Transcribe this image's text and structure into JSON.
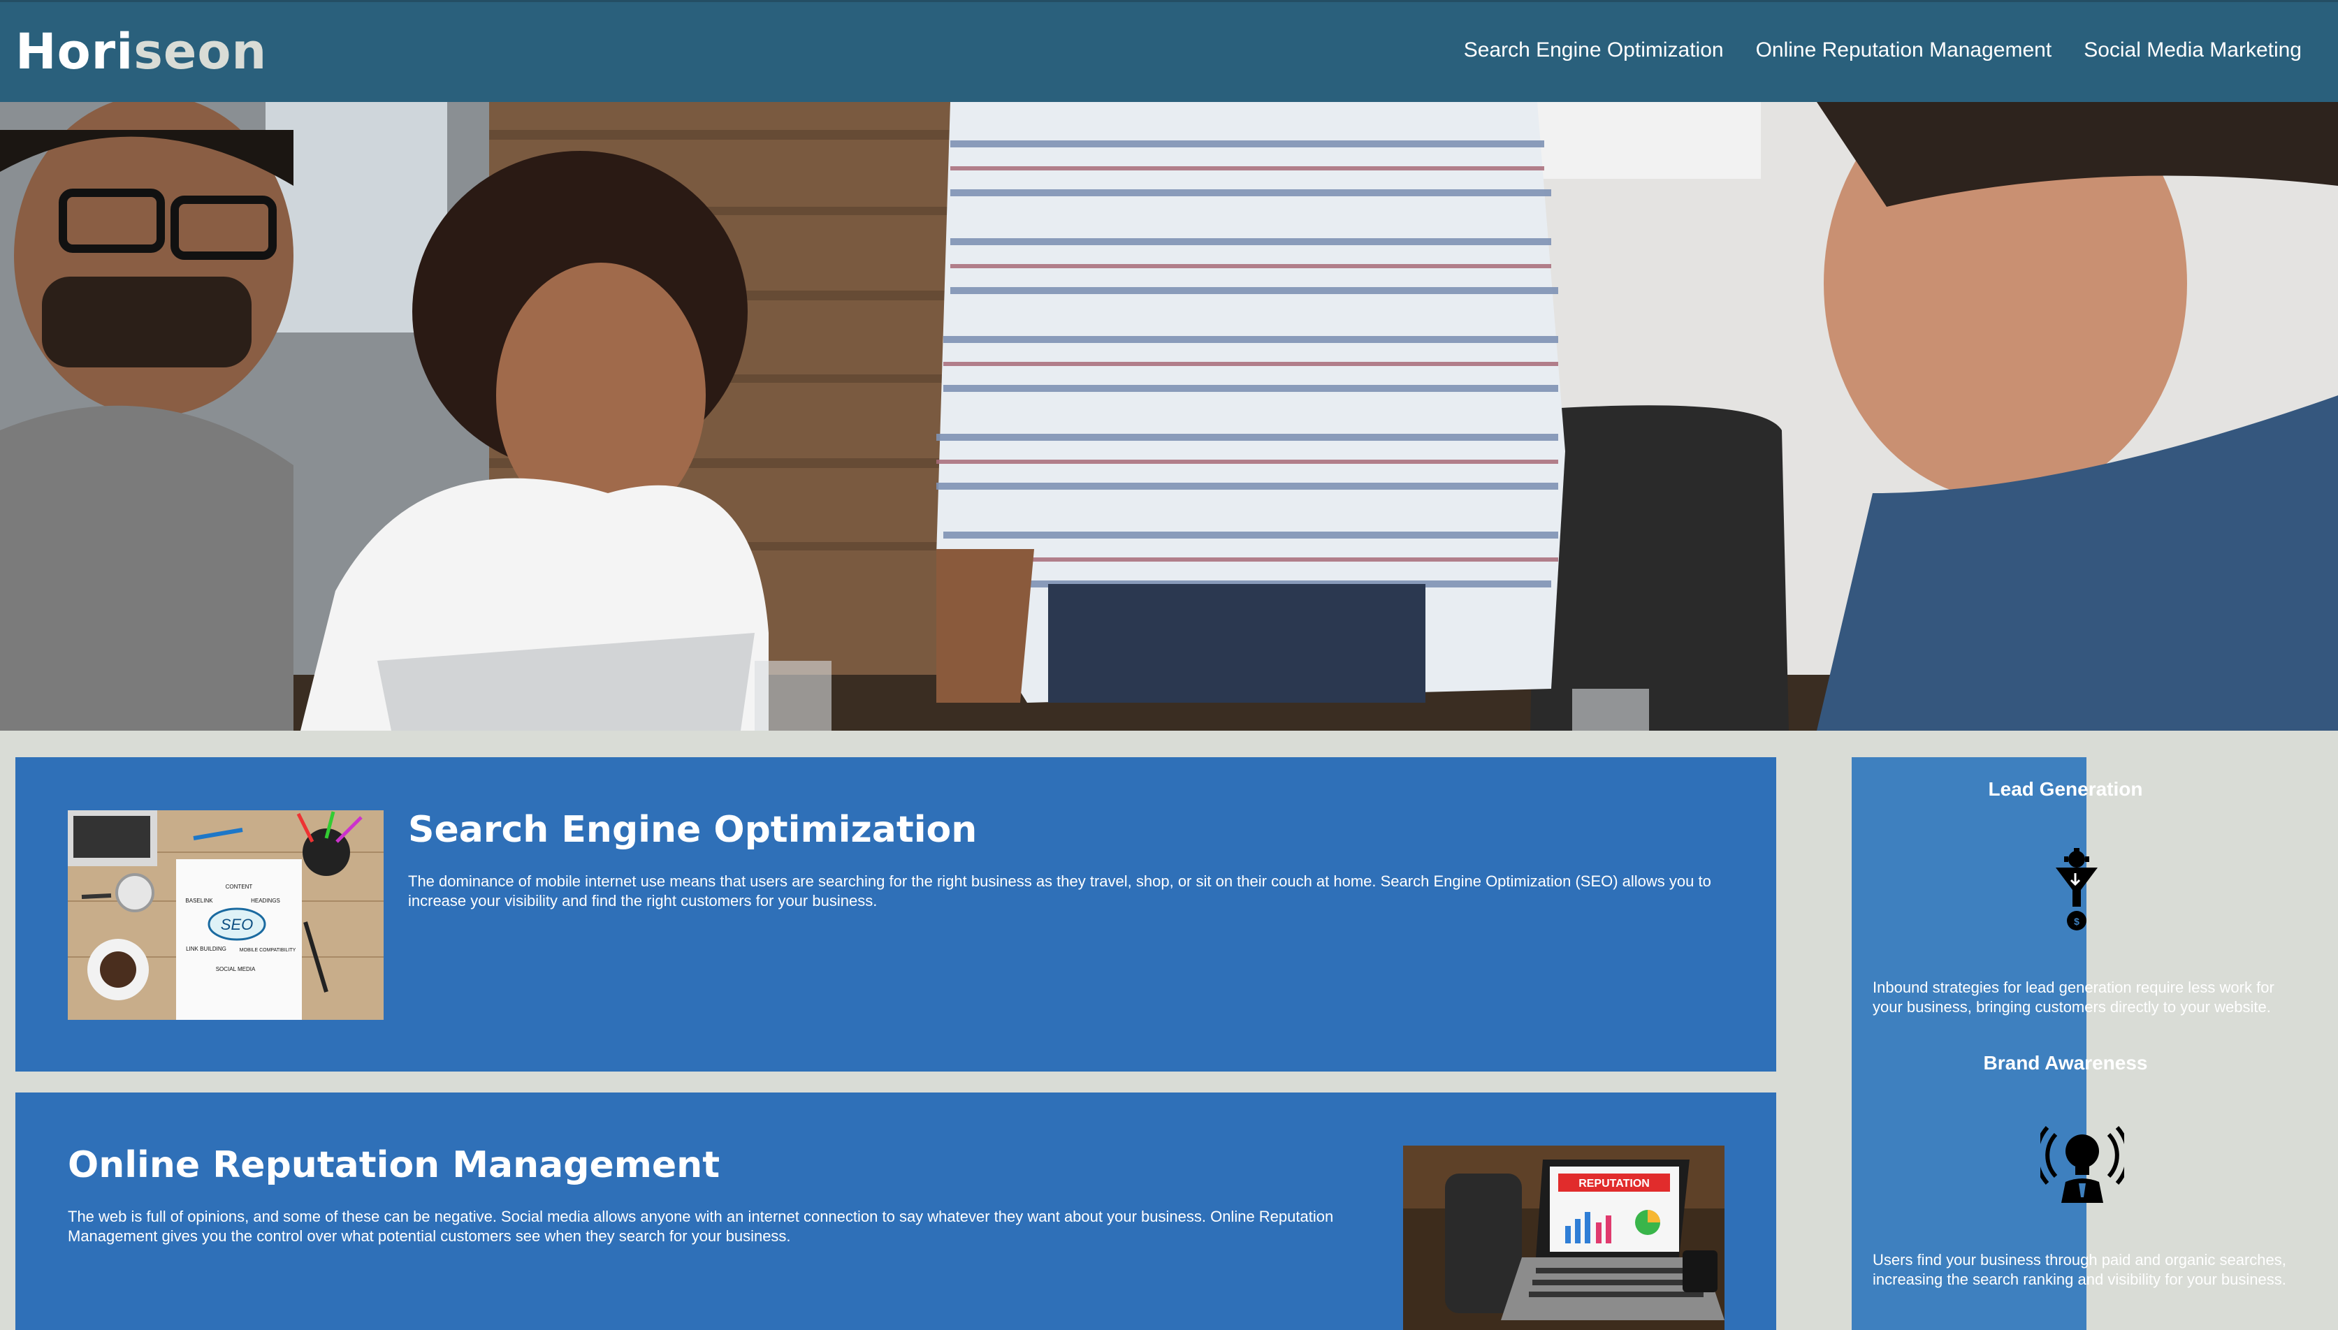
{
  "header": {
    "logo_main": "Hori",
    "logo_accent": "seon",
    "nav": [
      "Search Engine Optimization",
      "Online Reputation Management",
      "Social Media Marketing"
    ]
  },
  "hero": {
    "alt": "hero-image-team-meeting"
  },
  "sections": {
    "seo": {
      "title": "Search Engine Optimization",
      "text": "The dominance of mobile internet use means that users are searching for the right business as they travel, shop, or sit on their couch at home. Search Engine Optimization (SEO) allows you to increase your visibility and find the right customers for your business.",
      "image_words": [
        "CONTENT",
        "BASELINK",
        "HEADINGS",
        "SEO",
        "LINK BUILDING",
        "MOBILE COMPATIBILITY",
        "SOCIAL MEDIA"
      ]
    },
    "orm": {
      "title": "Online Reputation Management",
      "text": "The web is full of opinions, and some of these can be negative. Social media allows anyone with an internet connection to say whatever they want about your business. Online Reputation Management gives you the control over what potential customers see when they search for your business.",
      "image_word": "REPUTATION"
    }
  },
  "sidebar": {
    "lead": {
      "title": "Lead Generation",
      "text": "Inbound strategies for lead generation require less work for your business, bringing customers directly to your website."
    },
    "brand": {
      "title": "Brand Awareness",
      "text": "Users find your business through paid and organic searches, increasing the search ranking and visibility for your business."
    }
  },
  "colors": {
    "header_bg": "#2a607c",
    "page_bg": "#d9dcd6",
    "card_bg": "#2f70b8",
    "sidebar_bg": "#3e80bf"
  }
}
